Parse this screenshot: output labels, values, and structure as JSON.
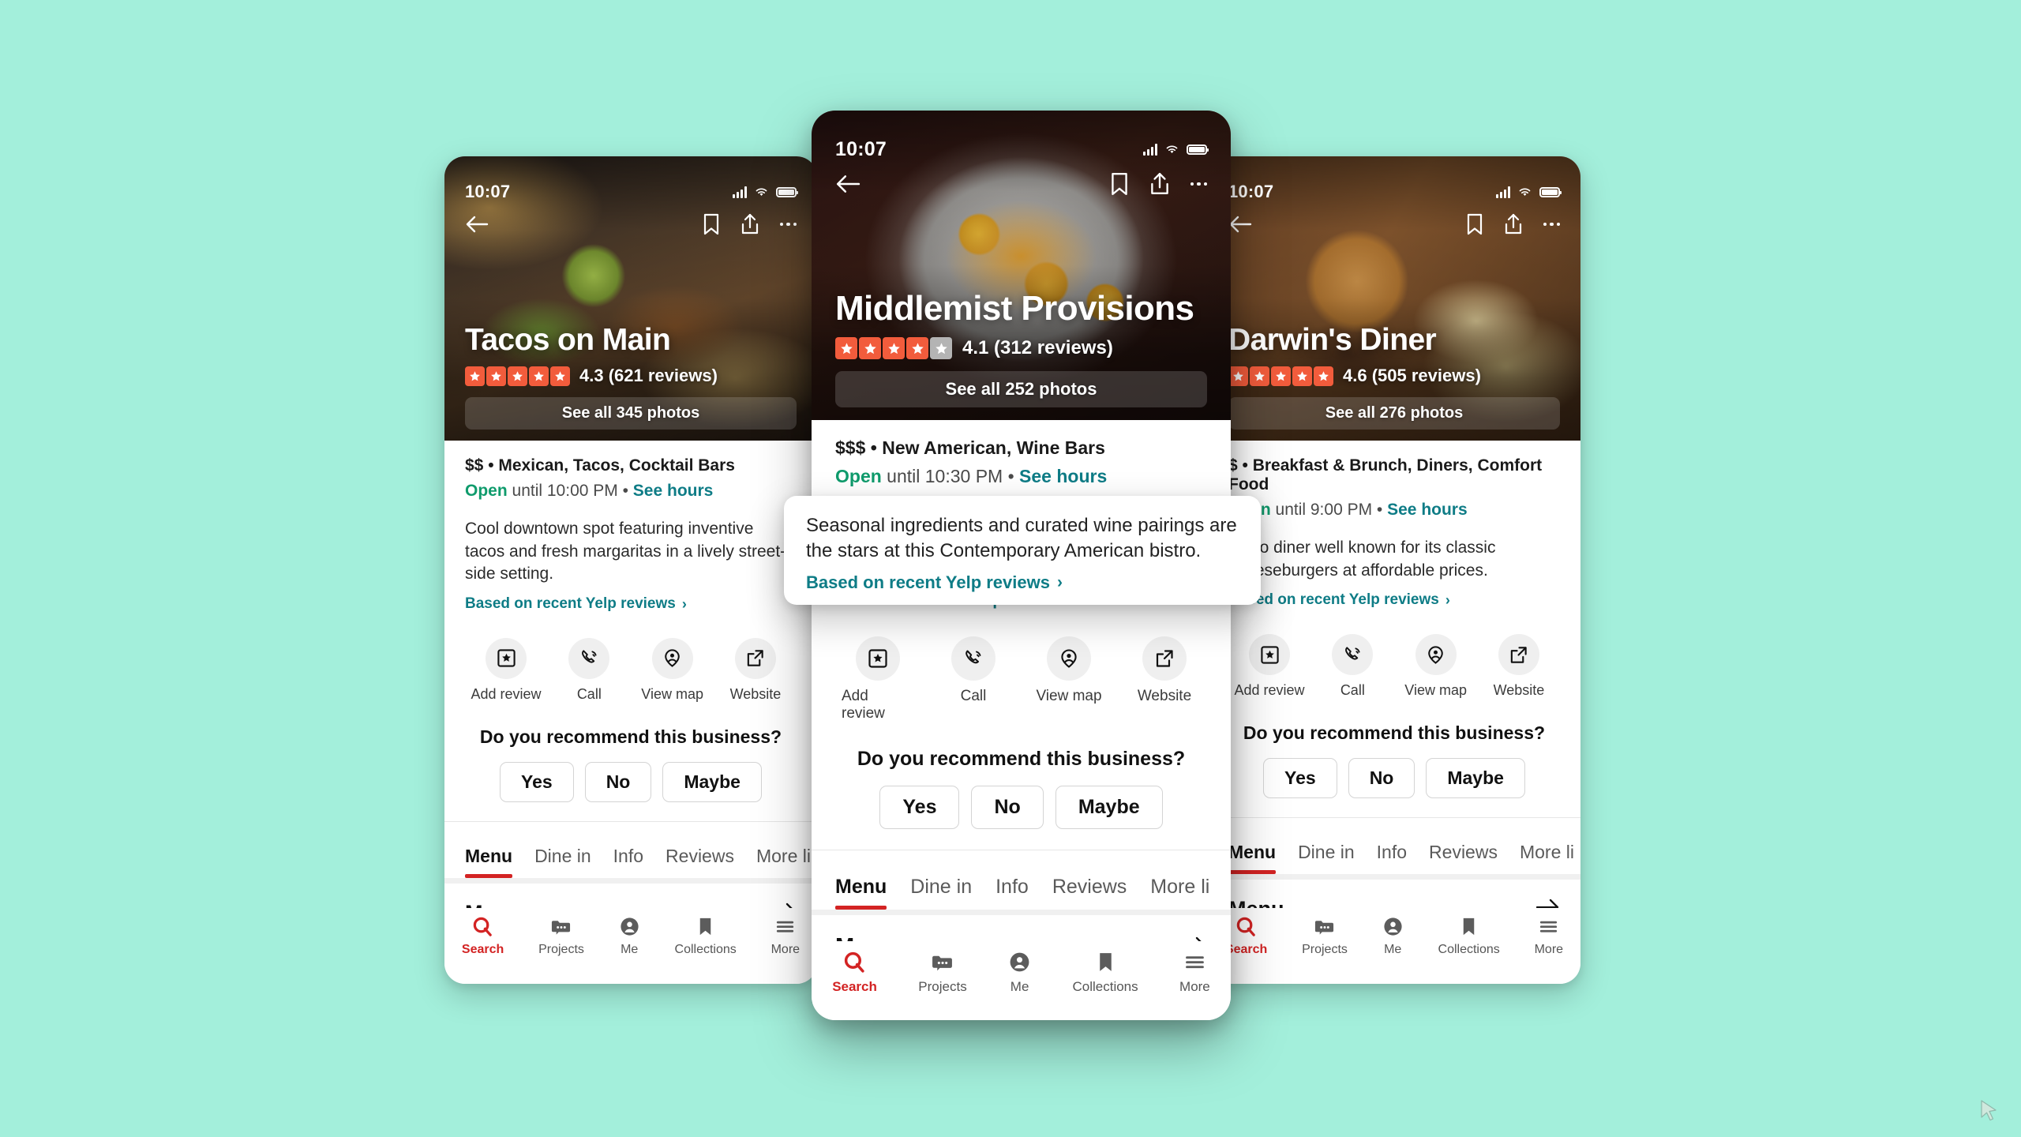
{
  "theme": {
    "background": "#a3efdb",
    "accent_red": "#d32323",
    "star_on": "#f25c3c",
    "star_off": "#b4b4b4",
    "link_teal": "#0e7c86",
    "open_green": "#0f9b6c"
  },
  "status_bar": {
    "time": "10:07",
    "icons": [
      "signal-icon",
      "wifi-icon",
      "battery-icon"
    ]
  },
  "hero_actions": {
    "back": "back-arrow-icon",
    "bookmark": "bookmark-icon",
    "share": "share-icon",
    "more": "more-dots-icon"
  },
  "action_buttons": [
    {
      "label": "Add review",
      "icon": "add-review-icon"
    },
    {
      "label": "Call",
      "icon": "phone-icon"
    },
    {
      "label": "View map",
      "icon": "map-pin-icon"
    },
    {
      "label": "Website",
      "icon": "external-link-icon"
    }
  ],
  "recommend": {
    "question": "Do you recommend this business?",
    "options": [
      "Yes",
      "No",
      "Maybe"
    ]
  },
  "tabs": [
    "Menu",
    "Dine in",
    "Info",
    "Reviews",
    "More li"
  ],
  "active_tab": "Menu",
  "menu_section": {
    "title": "Menu",
    "arrow": "arrow-right-icon"
  },
  "bottom_nav": {
    "active": "Search",
    "items": [
      {
        "label": "Search",
        "icon": "search-icon"
      },
      {
        "label": "Projects",
        "icon": "projects-folder-icon"
      },
      {
        "label": "Me",
        "icon": "profile-avatar-icon"
      },
      {
        "label": "Collections",
        "icon": "bookmark-icon"
      },
      {
        "label": "More",
        "icon": "hamburger-menu-icon"
      }
    ]
  },
  "cards": {
    "left": {
      "name": "Tacos on Main",
      "rating": "4.3",
      "reviews": "(621 reviews)",
      "stars_filled": 5,
      "stars_total": 5,
      "photos_button": "See all 345 photos",
      "price_and_categories": "$$ • Mexican, Tacos, Cocktail Bars",
      "open_word": "Open",
      "hours": "until 10:00 PM",
      "see_hours": "See hours",
      "description": "Cool downtown spot featuring inventive tacos and fresh margaritas in a lively street-side setting.",
      "based_on": "Based on recent Yelp reviews"
    },
    "center": {
      "name": "Middlemist Provisions",
      "rating": "4.1",
      "reviews": "(312 reviews)",
      "stars_filled": 4,
      "stars_total": 5,
      "photos_button": "See all 252 photos",
      "price_and_categories": "$$$ • New American, Wine Bars",
      "open_word": "Open",
      "hours": "until 10:30 PM",
      "see_hours": "See hours",
      "description": "Seasonal ingredients and curated wine pairings are the stars at this Contemporary American bistro.",
      "based_on": "Based on recent Yelp reviews"
    },
    "right": {
      "name": "Darwin's Diner",
      "rating": "4.6",
      "reviews": "(505 reviews)",
      "stars_filled": 5,
      "stars_total": 5,
      "photos_button": "See all 276 photos",
      "price_and_categories": "$ • Breakfast & Brunch, Diners, Comfort Food",
      "open_word": "Open",
      "hours": "until 9:00 PM",
      "see_hours": "See hours",
      "description": "Retro diner well known for its classic cheeseburgers at affordable prices.",
      "based_on": "Based on recent Yelp reviews"
    }
  },
  "overlay_tooltip": {
    "description": "Seasonal ingredients and curated wine pairings are the stars at this Contemporary American bistro.",
    "link": "Based on recent Yelp reviews"
  }
}
